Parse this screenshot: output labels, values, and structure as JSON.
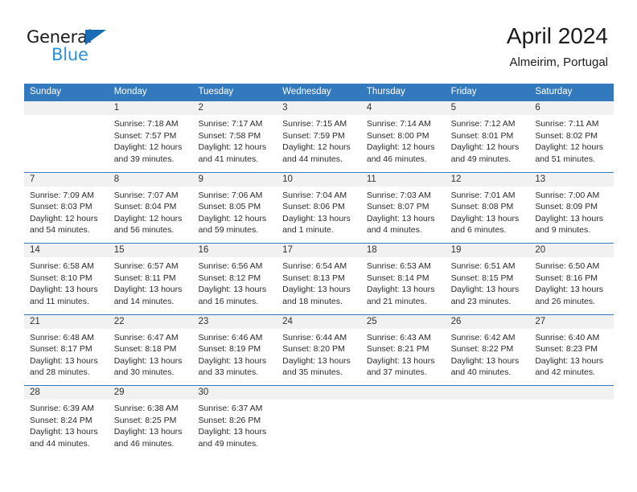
{
  "brand": {
    "name_top": "General",
    "name_bottom": "Blue",
    "triangle_color": "#1b6cb5",
    "blue_text_color": "#2e8fd8"
  },
  "header": {
    "title": "April 2024",
    "subtitle": "Almeirim, Portugal"
  },
  "theme": {
    "header_row_bg": "#3379bd",
    "header_row_text": "#ffffff",
    "daynum_band_bg": "#f1f1f1",
    "row_separator": "#3379bd",
    "body_text": "#2b2b2b"
  },
  "weekdays": [
    "Sunday",
    "Monday",
    "Tuesday",
    "Wednesday",
    "Thursday",
    "Friday",
    "Saturday"
  ],
  "labels": {
    "sunrise_prefix": "Sunrise:",
    "sunset_prefix": "Sunset:",
    "daylight_prefix": "Daylight:"
  },
  "weeks": [
    {
      "days": [
        {
          "num": "",
          "empty": true,
          "sunrise": "",
          "sunset": "",
          "daylight_line1": "",
          "daylight_line2": ""
        },
        {
          "num": "1",
          "empty": false,
          "sunrise": "Sunrise: 7:18 AM",
          "sunset": "Sunset: 7:57 PM",
          "daylight_line1": "Daylight: 12 hours",
          "daylight_line2": "and 39 minutes."
        },
        {
          "num": "2",
          "empty": false,
          "sunrise": "Sunrise: 7:17 AM",
          "sunset": "Sunset: 7:58 PM",
          "daylight_line1": "Daylight: 12 hours",
          "daylight_line2": "and 41 minutes."
        },
        {
          "num": "3",
          "empty": false,
          "sunrise": "Sunrise: 7:15 AM",
          "sunset": "Sunset: 7:59 PM",
          "daylight_line1": "Daylight: 12 hours",
          "daylight_line2": "and 44 minutes."
        },
        {
          "num": "4",
          "empty": false,
          "sunrise": "Sunrise: 7:14 AM",
          "sunset": "Sunset: 8:00 PM",
          "daylight_line1": "Daylight: 12 hours",
          "daylight_line2": "and 46 minutes."
        },
        {
          "num": "5",
          "empty": false,
          "sunrise": "Sunrise: 7:12 AM",
          "sunset": "Sunset: 8:01 PM",
          "daylight_line1": "Daylight: 12 hours",
          "daylight_line2": "and 49 minutes."
        },
        {
          "num": "6",
          "empty": false,
          "sunrise": "Sunrise: 7:11 AM",
          "sunset": "Sunset: 8:02 PM",
          "daylight_line1": "Daylight: 12 hours",
          "daylight_line2": "and 51 minutes."
        }
      ]
    },
    {
      "days": [
        {
          "num": "7",
          "empty": false,
          "sunrise": "Sunrise: 7:09 AM",
          "sunset": "Sunset: 8:03 PM",
          "daylight_line1": "Daylight: 12 hours",
          "daylight_line2": "and 54 minutes."
        },
        {
          "num": "8",
          "empty": false,
          "sunrise": "Sunrise: 7:07 AM",
          "sunset": "Sunset: 8:04 PM",
          "daylight_line1": "Daylight: 12 hours",
          "daylight_line2": "and 56 minutes."
        },
        {
          "num": "9",
          "empty": false,
          "sunrise": "Sunrise: 7:06 AM",
          "sunset": "Sunset: 8:05 PM",
          "daylight_line1": "Daylight: 12 hours",
          "daylight_line2": "and 59 minutes."
        },
        {
          "num": "10",
          "empty": false,
          "sunrise": "Sunrise: 7:04 AM",
          "sunset": "Sunset: 8:06 PM",
          "daylight_line1": "Daylight: 13 hours",
          "daylight_line2": "and 1 minute."
        },
        {
          "num": "11",
          "empty": false,
          "sunrise": "Sunrise: 7:03 AM",
          "sunset": "Sunset: 8:07 PM",
          "daylight_line1": "Daylight: 13 hours",
          "daylight_line2": "and 4 minutes."
        },
        {
          "num": "12",
          "empty": false,
          "sunrise": "Sunrise: 7:01 AM",
          "sunset": "Sunset: 8:08 PM",
          "daylight_line1": "Daylight: 13 hours",
          "daylight_line2": "and 6 minutes."
        },
        {
          "num": "13",
          "empty": false,
          "sunrise": "Sunrise: 7:00 AM",
          "sunset": "Sunset: 8:09 PM",
          "daylight_line1": "Daylight: 13 hours",
          "daylight_line2": "and 9 minutes."
        }
      ]
    },
    {
      "days": [
        {
          "num": "14",
          "empty": false,
          "sunrise": "Sunrise: 6:58 AM",
          "sunset": "Sunset: 8:10 PM",
          "daylight_line1": "Daylight: 13 hours",
          "daylight_line2": "and 11 minutes."
        },
        {
          "num": "15",
          "empty": false,
          "sunrise": "Sunrise: 6:57 AM",
          "sunset": "Sunset: 8:11 PM",
          "daylight_line1": "Daylight: 13 hours",
          "daylight_line2": "and 14 minutes."
        },
        {
          "num": "16",
          "empty": false,
          "sunrise": "Sunrise: 6:56 AM",
          "sunset": "Sunset: 8:12 PM",
          "daylight_line1": "Daylight: 13 hours",
          "daylight_line2": "and 16 minutes."
        },
        {
          "num": "17",
          "empty": false,
          "sunrise": "Sunrise: 6:54 AM",
          "sunset": "Sunset: 8:13 PM",
          "daylight_line1": "Daylight: 13 hours",
          "daylight_line2": "and 18 minutes."
        },
        {
          "num": "18",
          "empty": false,
          "sunrise": "Sunrise: 6:53 AM",
          "sunset": "Sunset: 8:14 PM",
          "daylight_line1": "Daylight: 13 hours",
          "daylight_line2": "and 21 minutes."
        },
        {
          "num": "19",
          "empty": false,
          "sunrise": "Sunrise: 6:51 AM",
          "sunset": "Sunset: 8:15 PM",
          "daylight_line1": "Daylight: 13 hours",
          "daylight_line2": "and 23 minutes."
        },
        {
          "num": "20",
          "empty": false,
          "sunrise": "Sunrise: 6:50 AM",
          "sunset": "Sunset: 8:16 PM",
          "daylight_line1": "Daylight: 13 hours",
          "daylight_line2": "and 26 minutes."
        }
      ]
    },
    {
      "days": [
        {
          "num": "21",
          "empty": false,
          "sunrise": "Sunrise: 6:48 AM",
          "sunset": "Sunset: 8:17 PM",
          "daylight_line1": "Daylight: 13 hours",
          "daylight_line2": "and 28 minutes."
        },
        {
          "num": "22",
          "empty": false,
          "sunrise": "Sunrise: 6:47 AM",
          "sunset": "Sunset: 8:18 PM",
          "daylight_line1": "Daylight: 13 hours",
          "daylight_line2": "and 30 minutes."
        },
        {
          "num": "23",
          "empty": false,
          "sunrise": "Sunrise: 6:46 AM",
          "sunset": "Sunset: 8:19 PM",
          "daylight_line1": "Daylight: 13 hours",
          "daylight_line2": "and 33 minutes."
        },
        {
          "num": "24",
          "empty": false,
          "sunrise": "Sunrise: 6:44 AM",
          "sunset": "Sunset: 8:20 PM",
          "daylight_line1": "Daylight: 13 hours",
          "daylight_line2": "and 35 minutes."
        },
        {
          "num": "25",
          "empty": false,
          "sunrise": "Sunrise: 6:43 AM",
          "sunset": "Sunset: 8:21 PM",
          "daylight_line1": "Daylight: 13 hours",
          "daylight_line2": "and 37 minutes."
        },
        {
          "num": "26",
          "empty": false,
          "sunrise": "Sunrise: 6:42 AM",
          "sunset": "Sunset: 8:22 PM",
          "daylight_line1": "Daylight: 13 hours",
          "daylight_line2": "and 40 minutes."
        },
        {
          "num": "27",
          "empty": false,
          "sunrise": "Sunrise: 6:40 AM",
          "sunset": "Sunset: 8:23 PM",
          "daylight_line1": "Daylight: 13 hours",
          "daylight_line2": "and 42 minutes."
        }
      ]
    },
    {
      "days": [
        {
          "num": "28",
          "empty": false,
          "sunrise": "Sunrise: 6:39 AM",
          "sunset": "Sunset: 8:24 PM",
          "daylight_line1": "Daylight: 13 hours",
          "daylight_line2": "and 44 minutes."
        },
        {
          "num": "29",
          "empty": false,
          "sunrise": "Sunrise: 6:38 AM",
          "sunset": "Sunset: 8:25 PM",
          "daylight_line1": "Daylight: 13 hours",
          "daylight_line2": "and 46 minutes."
        },
        {
          "num": "30",
          "empty": false,
          "sunrise": "Sunrise: 6:37 AM",
          "sunset": "Sunset: 8:26 PM",
          "daylight_line1": "Daylight: 13 hours",
          "daylight_line2": "and 49 minutes."
        },
        {
          "num": "",
          "empty": true,
          "sunrise": "",
          "sunset": "",
          "daylight_line1": "",
          "daylight_line2": ""
        },
        {
          "num": "",
          "empty": true,
          "sunrise": "",
          "sunset": "",
          "daylight_line1": "",
          "daylight_line2": ""
        },
        {
          "num": "",
          "empty": true,
          "sunrise": "",
          "sunset": "",
          "daylight_line1": "",
          "daylight_line2": ""
        },
        {
          "num": "",
          "empty": true,
          "sunrise": "",
          "sunset": "",
          "daylight_line1": "",
          "daylight_line2": ""
        }
      ]
    }
  ]
}
